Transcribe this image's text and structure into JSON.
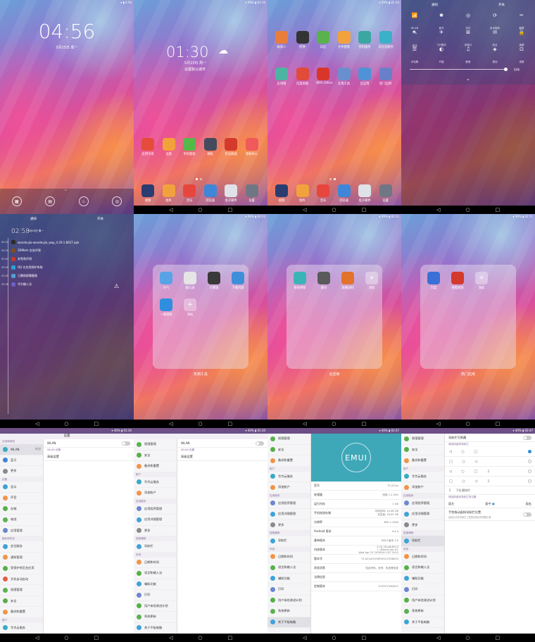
{
  "lock": {
    "time": "04:56",
    "date": "5月15日 周一"
  },
  "home1": {
    "time": "01:30",
    "date": "5月15日 周一",
    "city": "设置默认城市",
    "apps": [
      {
        "label": "应用市场",
        "color": "#e54c3c"
      },
      {
        "label": "主题",
        "color": "#f3a13a"
      },
      {
        "label": "手机管家",
        "color": "#55b94a"
      },
      {
        "label": "相机",
        "color": "#444b5c"
      },
      {
        "label": "华为商城",
        "color": "#d33a2c"
      },
      {
        "label": "游戏中心",
        "color": "#f05a5a"
      }
    ],
    "dock": [
      {
        "label": "视频",
        "color": "#2a3d70"
      },
      {
        "label": "图库",
        "color": "#f2a23c"
      },
      {
        "label": "音乐",
        "color": "#e8463c"
      },
      {
        "label": "浏览器",
        "color": "#3f86d8"
      },
      {
        "label": "电子邮件",
        "color": "#dfe2e8"
      },
      {
        "label": "设置",
        "color": "#707784"
      }
    ]
  },
  "home2": {
    "apps": [
      {
        "label": "联系人",
        "color": "#e97d3a"
      },
      {
        "label": "时钟",
        "color": "#333"
      },
      {
        "label": "日历",
        "color": "#5ab24e"
      },
      {
        "label": "文件管理",
        "color": "#f2a23c"
      },
      {
        "label": "手机服务",
        "color": "#3aa7a0"
      },
      {
        "label": "华为云服务",
        "color": "#3ab0c9"
      },
      {
        "label": "应用锁",
        "color": "#4cb5a2"
      },
      {
        "label": "百度地图",
        "color": "#e04b3a"
      },
      {
        "label": "WPS Office",
        "color": "#d9362b"
      },
      {
        "label": "实用工具",
        "color": "#6a8fcf"
      },
      {
        "label": "云应用",
        "color": "#4f92d7"
      },
      {
        "label": "热门应用",
        "color": "#6a7fc9"
      }
    ]
  },
  "quick": {
    "tab1": "通知",
    "tab2": "开关",
    "toggles": [
      {
        "g": "📶",
        "t": "WLAN"
      },
      {
        "g": "✱",
        "t": "蓝牙"
      },
      {
        "g": "◎",
        "t": "定位"
      },
      {
        "g": "⟳",
        "t": "自动旋转"
      },
      {
        "g": "✂",
        "t": "截屏"
      },
      {
        "g": "⛐",
        "t": "省流"
      },
      {
        "g": "✈",
        "t": "飞行模式"
      },
      {
        "g": "⊞",
        "t": "多窗口"
      },
      {
        "g": "✉",
        "t": "热点"
      },
      {
        "g": "🔒",
        "t": "锁屏"
      },
      {
        "g": "☰",
        "t": "手电筒"
      },
      {
        "g": "◐",
        "t": "节能"
      },
      {
        "g": "♫",
        "t": "静音"
      },
      {
        "g": "◈",
        "t": "振动"
      },
      {
        "g": "⊡",
        "t": "录屏"
      }
    ],
    "auto": "自动"
  },
  "notif": {
    "tab1": "通知",
    "tab2": "开关",
    "time": "02:58",
    "date": "5月15日 周一",
    "items": [
      {
        "t": "04:41",
        "title": "wandoujia-wandoujia_wap_4.29.1.8027.apk",
        "color": "#2c2c2c"
      },
      {
        "t": "04:29",
        "title": "3DMark 应该评测",
        "color": "#7d4e1f"
      },
      {
        "t": "03:52",
        "title": "安兔兔评测",
        "color": "#c13b2b"
      },
      {
        "t": "03:45",
        "title": "QQ 在应用保护系统",
        "color": "#2b9fd8"
      },
      {
        "t": "03:45",
        "title": "已删除屏幕截图",
        "color": "#4fa0d0"
      },
      {
        "t": "03:38",
        "title": "华为输入法",
        "color": "#6e5fc6"
      }
    ]
  },
  "folder1": {
    "title": "实用工具",
    "apps": [
      {
        "label": "天气",
        "color": "#57a3e6"
      },
      {
        "label": "备忘录",
        "color": "#e5e5e5"
      },
      {
        "label": "计算器",
        "color": "#3a3a3a"
      },
      {
        "label": "下载内容",
        "color": "#3d8fd9"
      },
      {
        "label": "一键锁屏",
        "color": "#2f8ee0"
      },
      {
        "label": "添加",
        "color": "rgba(255,255,255,.35)"
      }
    ]
  },
  "folder2": {
    "title": "云应用",
    "apps": [
      {
        "label": "系统更新",
        "color": "#3bb4b8"
      },
      {
        "label": "备份",
        "color": "#5a5a5a"
      },
      {
        "label": "屏幕录制",
        "color": "#e3722c"
      },
      {
        "label": "添加",
        "color": "rgba(255,255,255,.35)"
      }
    ]
  },
  "folder3": {
    "title": "热门应用",
    "apps": [
      {
        "label": "百度",
        "color": "#3a6fd6"
      },
      {
        "label": "搜狐视频",
        "color": "#d43a2c"
      },
      {
        "label": "添加",
        "color": "rgba(255,255,255,.35)"
      }
    ]
  },
  "settings1": {
    "title": "设置",
    "side": [
      {
        "cat": "无线和网络"
      },
      {
        "label": "WLAN",
        "color": "#39a9c4",
        "val": "关闭",
        "sel": true
      },
      {
        "label": "蓝牙",
        "color": "#3f84d8"
      },
      {
        "label": "更多",
        "color": "#8a8a8a"
      },
      {
        "cat": "设备"
      },
      {
        "label": "显示",
        "color": "#3fa2d8"
      },
      {
        "label": "声音",
        "color": "#f0944a"
      },
      {
        "label": "存储",
        "color": "#56b047"
      },
      {
        "label": "电池",
        "color": "#5ab24e"
      },
      {
        "label": "应用管理",
        "color": "#6c86cf"
      },
      {
        "cat": "隐私和安全"
      },
      {
        "label": "定位服务",
        "color": "#3fa2d8"
      },
      {
        "label": "通知管理",
        "color": "#f0944a"
      },
      {
        "label": "受保护的后台应用",
        "color": "#56b047"
      },
      {
        "label": "开机自动启动",
        "color": "#e85c46"
      },
      {
        "label": "权限管理",
        "color": "#5ab24e"
      },
      {
        "label": "安全",
        "color": "#56b047"
      },
      {
        "label": "备份和重置",
        "color": "#f0944a"
      },
      {
        "cat": "账户"
      },
      {
        "label": "华为云服务",
        "color": "#39a9c4"
      }
    ],
    "main": [
      {
        "label": "WLAN",
        "toggle": true
      },
      {
        "cat": "WLAN 设置"
      },
      {
        "label": "高级设置"
      }
    ]
  },
  "settings2": {
    "side": [
      {
        "label": "权限管理",
        "color": "#5ab24e"
      },
      {
        "label": "安全",
        "color": "#56b047"
      },
      {
        "label": "备份和重置",
        "color": "#f0944a"
      },
      {
        "cat": "账户"
      },
      {
        "label": "华为云服务",
        "color": "#39a9c4"
      },
      {
        "label": "添加账户",
        "color": "#f0944a"
      },
      {
        "cat": "应用程序"
      },
      {
        "label": "应用程序管理",
        "color": "#6c86cf"
      },
      {
        "label": "应用详细管理",
        "color": "#3fa2d8"
      },
      {
        "label": "更多",
        "color": "#8a8a8a"
      },
      {
        "cat": "智能辅助"
      },
      {
        "label": "导航栏",
        "color": "#3fa2d8"
      },
      {
        "cat": "系统"
      },
      {
        "label": "日期和时间",
        "color": "#f0944a"
      },
      {
        "label": "语言和输入法",
        "color": "#56b047"
      },
      {
        "label": "辅助功能",
        "color": "#3fa2d8"
      },
      {
        "label": "打印",
        "color": "#6c86cf"
      },
      {
        "label": "用户体验改进计划",
        "color": "#56b047"
      },
      {
        "label": "系统更新",
        "color": "#5ab24e"
      },
      {
        "label": "关于平板电脑",
        "color": "#3fa2d8"
      }
    ],
    "main": [
      {
        "label": "WLAN",
        "toggle": true
      },
      {
        "cat": "WLAN 设置"
      },
      {
        "label": "高级设置"
      }
    ]
  },
  "about": {
    "brand": "EMUI",
    "side": [
      {
        "label": "权限管理",
        "color": "#5ab24e"
      },
      {
        "label": "安全",
        "color": "#56b047"
      },
      {
        "label": "备份和重置",
        "color": "#f0944a"
      },
      {
        "cat": "账户"
      },
      {
        "label": "华为云服务",
        "color": "#39a9c4"
      },
      {
        "label": "添加账户",
        "color": "#f0944a"
      },
      {
        "cat": "应用程序"
      },
      {
        "label": "应用程序管理",
        "color": "#6c86cf"
      },
      {
        "label": "应用详细管理",
        "color": "#3fa2d8"
      },
      {
        "label": "更多",
        "color": "#8a8a8a"
      },
      {
        "cat": "智能辅助"
      },
      {
        "label": "导航栏",
        "color": "#3fa2d8"
      },
      {
        "cat": "系统"
      },
      {
        "label": "日期和时间",
        "color": "#f0944a"
      },
      {
        "label": "语言和输入法",
        "color": "#56b047"
      },
      {
        "label": "辅助功能",
        "color": "#3fa2d8"
      },
      {
        "label": "打印",
        "color": "#6c86cf"
      },
      {
        "label": "用户体验改进计划",
        "color": "#56b047"
      },
      {
        "label": "系统更新",
        "color": "#5ab24e"
      },
      {
        "label": "关于平板电脑",
        "color": "#3fa2d8",
        "sel": true
      }
    ],
    "rows": [
      {
        "k": "型号",
        "v": "T1-A21w"
      },
      {
        "k": "处理器",
        "v": "四核 1.2 GHz"
      },
      {
        "k": "运行内存",
        "v": "1 GB"
      },
      {
        "k": "手机电池存储",
        "v": "可用空间: 10.46 GB\n总容量: 16.00 GB"
      },
      {
        "k": "分辨率",
        "v": "800 x 1280"
      },
      {
        "k": "Android 版本",
        "v": "4.4.4"
      },
      {
        "k": "基带版本",
        "v": "EMUI 版本 3.0"
      },
      {
        "k": "内核版本",
        "v": "3.10.28-g6c8914\nj...@euler-lab #1\nWed Apr 22 20:58:00 CST 2015"
      },
      {
        "k": "版本号",
        "v": "T1-A21wV100R001C233B003"
      },
      {
        "k": "状态消息",
        "v": "电话号码、信号、电池等信息"
      },
      {
        "k": "法律信息",
        "v": ""
      },
      {
        "k": "定制版本",
        "v": "CUSTC233D001"
      }
    ]
  },
  "navbar": {
    "side": [
      {
        "label": "权限管理",
        "color": "#5ab24e"
      },
      {
        "label": "安全",
        "color": "#56b047"
      },
      {
        "label": "备份和重置",
        "color": "#f0944a"
      },
      {
        "cat": "账户"
      },
      {
        "label": "华为云服务",
        "color": "#39a9c4"
      },
      {
        "label": "添加账户",
        "color": "#f0944a"
      },
      {
        "cat": "应用程序"
      },
      {
        "label": "应用程序管理",
        "color": "#6c86cf"
      },
      {
        "label": "应用详细管理",
        "color": "#3fa2d8"
      },
      {
        "label": "更多",
        "color": "#8a8a8a"
      },
      {
        "cat": "智能辅助"
      },
      {
        "label": "导航栏",
        "color": "#3fa2d8",
        "sel": true
      },
      {
        "cat": "系统"
      },
      {
        "label": "日期和时间",
        "color": "#f0944a"
      },
      {
        "label": "语言和输入法",
        "color": "#56b047"
      },
      {
        "label": "辅助功能",
        "color": "#3fa2d8"
      },
      {
        "label": "打印",
        "color": "#6c86cf"
      },
      {
        "label": "用户体验改进计划",
        "color": "#56b047"
      },
      {
        "label": "系统更新",
        "color": "#5ab24e"
      },
      {
        "label": "关于平板电脑",
        "color": "#3fa2d8"
      }
    ],
    "hide": "导航栏可隐藏",
    "pick": "请选择虚拟导航栏",
    "combos": [
      "◁ ○ □",
      "□ ○ ◁",
      "◁ ○ □ ⇩",
      "□ ○ ◁ ⇩"
    ],
    "pull": "下拉通知栏",
    "pos_label": "请选择虚拟导航栏的位置",
    "pos": [
      "居左",
      "居中",
      "居右"
    ],
    "follow": "手势拖动虚拟导航栏位置",
    "follow_hint": "启用后可在导航栏上短按并拖动来调整位置"
  }
}
